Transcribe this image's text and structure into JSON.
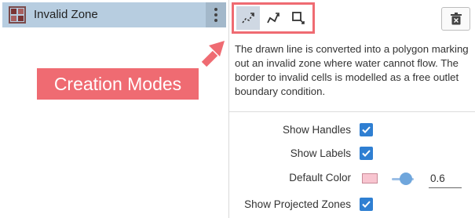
{
  "layer": {
    "name": "Invalid Zone"
  },
  "toolbar": {
    "modes": [
      {
        "icon": "draw-line-icon",
        "active": true
      },
      {
        "icon": "draw-polyline-icon",
        "active": false
      },
      {
        "icon": "draw-rectangle-icon",
        "active": false
      }
    ],
    "delete_icon": "trash-icon"
  },
  "description": "The drawn line is converted into a polygon marking out an invalid zone where water cannot flow. The border to invalid cells is modelled as a free outlet boundary condition.",
  "settings": {
    "show_handles": {
      "label": "Show Handles",
      "checked": true
    },
    "show_labels": {
      "label": "Show Labels",
      "checked": true
    },
    "default_color": {
      "label": "Default Color",
      "color": "#f8c5d0",
      "opacity": "0.6"
    },
    "show_projected_zones": {
      "label": "Show Projected Zones",
      "checked": true
    }
  },
  "annotation": {
    "label": "Creation Modes",
    "color": "#ef6b72"
  },
  "colors": {
    "accent": "#2f7fd2",
    "selected_row": "#b7cde0",
    "annotation": "#ef6b72"
  }
}
